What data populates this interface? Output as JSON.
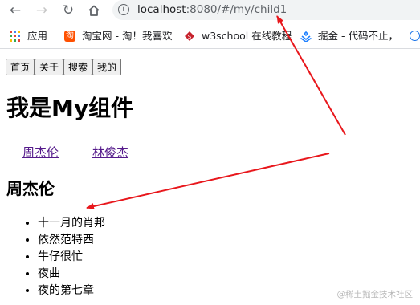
{
  "browser": {
    "back_icon": "arrow-left-icon",
    "forward_icon": "arrow-right-icon",
    "reload_icon": "reload-icon",
    "home_icon": "home-icon",
    "info_icon": "info-icon",
    "url_host": "localhost",
    "url_rest": ":8080/#/my/child1"
  },
  "bookmarks": [
    {
      "label": "应用",
      "icon": "apps-grid-icon"
    },
    {
      "label": "淘宝网 - 淘！我喜欢",
      "icon": "taobao-icon"
    },
    {
      "label": "w3school 在线教程",
      "icon": "w3school-icon"
    },
    {
      "label": "掘金 - 代码不止，",
      "icon": "juejin-icon"
    }
  ],
  "nav_buttons": [
    "首页",
    "关于",
    "搜索",
    "我的"
  ],
  "page": {
    "title": "我是My组件",
    "links": [
      "周杰伦",
      "林俊杰"
    ],
    "subtitle": "周杰伦",
    "songs": [
      "十一月的肖邦",
      "依然范特西",
      "牛仔很忙",
      "夜曲",
      "夜的第七章"
    ]
  },
  "watermark": "@稀土掘金技术社区",
  "colors": {
    "annotation_arrow": "#e8171c",
    "visited_link": "#551a8b"
  }
}
